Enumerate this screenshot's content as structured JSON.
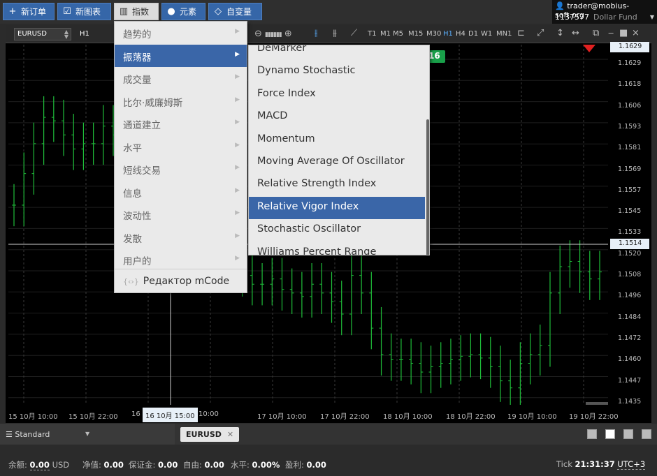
{
  "toolbar": {
    "new_order": "新订单",
    "new_chart": "新图表",
    "indicators": "指数",
    "elements": "元素",
    "variables": "自变量"
  },
  "account": {
    "user": "trader@mobius-soft.org",
    "id": "1137577",
    "fund": "Dollar Fund"
  },
  "chart_toolbar": {
    "symbol": "EURUSD",
    "timeframe": "H1",
    "timeframes": [
      "T1",
      "M1",
      "M5",
      "M15",
      "M30",
      "H1",
      "H4",
      "D1",
      "W1",
      "MN1"
    ],
    "active_timeframe": "H1"
  },
  "price_axis": {
    "ticks": [
      "1.1629",
      "1.1618",
      "1.1606",
      "1.1593",
      "1.1581",
      "1.1569",
      "1.1557",
      "1.1545",
      "1.1533",
      "1.1520",
      "1.1508",
      "1.1496",
      "1.1484",
      "1.1472",
      "1.1460",
      "1.1447",
      "1.1435"
    ],
    "current_price": "1.1514",
    "top_price": "1.1629"
  },
  "time_axis": {
    "labels": [
      "15 10月 10:00",
      "15 10月 22:00",
      "16",
      "16 10月 15:00",
      "10:00",
      "17 10月 10:00",
      "17 10月 22:00",
      "18 10月 10:00",
      "18 10月 22:00",
      "19 10月 10:00",
      "19 10月 22:00"
    ],
    "crosshair_time": "16 10月 15:00"
  },
  "chart_marker": "16",
  "menu": {
    "items": [
      "趋势的",
      "振荡器",
      "成交量",
      "比尔·威廉姆斯",
      "通道建立",
      "水平",
      "短线交易",
      "信息",
      "波动性",
      "发散",
      "用户的"
    ],
    "selected": "振荡器",
    "editor": "Редактор mCode"
  },
  "submenu": {
    "items": [
      "DeMarker",
      "Dynamo Stochastic",
      "Force Index",
      "MACD",
      "Momentum",
      "Moving Average Of Oscillator",
      "Relative Strength Index",
      "Relative Vigor Index",
      "Stochastic Oscillator",
      "Williams Percent Range"
    ],
    "selected": "Relative Vigor Index"
  },
  "tabbar": {
    "workspace": "Standard",
    "symbol_tab": "EURUSD"
  },
  "status": {
    "balance_label": "余额:",
    "balance_value": "0.00",
    "balance_currency": "USD",
    "equity_label": "净值:",
    "equity_value": "0.00",
    "margin_label": "保证金:",
    "margin_value": "0.00",
    "free_label": "自由:",
    "free_value": "0.00",
    "level_label": "水平:",
    "level_value": "0.00%",
    "profit_label": "盈利:",
    "profit_value": "0.00",
    "tick_label": "Tick",
    "time": "21:31:37",
    "timezone": "UTC+3"
  },
  "colors": {
    "accent": "#3a66a8",
    "candle": "#1fbf3a",
    "marker_green": "#19a04a",
    "marker_red": "#e02020"
  },
  "chart_data": {
    "type": "candlestick",
    "title": "",
    "symbol": "EURUSD",
    "timeframe": "H1",
    "ylim": [
      1.143,
      1.1635
    ],
    "x_tick_labels": [
      "15 10月 10:00",
      "15 10月 22:00",
      "16 10月 10:00",
      "17 10月 10:00",
      "17 10月 22:00",
      "18 10月 10:00",
      "18 10月 22:00",
      "19 10月 10:00",
      "19 10月 22:00"
    ],
    "series": [
      {
        "name": "EURUSD",
        "values": [
          1.155,
          1.1568,
          1.1585,
          1.16,
          1.1598,
          1.159,
          1.1582,
          1.1585,
          1.1585,
          1.1595,
          1.159,
          1.1586,
          1.158,
          1.1582,
          1.1575,
          1.1572,
          1.158,
          1.1585,
          1.1588,
          1.159,
          1.1584,
          1.152,
          1.1515,
          1.151,
          1.1505,
          1.1505,
          1.1508,
          1.1502,
          1.15,
          1.1498,
          1.1505,
          1.15,
          1.1495,
          1.1488,
          1.151,
          1.15,
          1.148,
          1.1465,
          1.1462,
          1.1462,
          1.146,
          1.1455,
          1.1458,
          1.146,
          1.1462,
          1.1464,
          1.1465,
          1.1463,
          1.1458,
          1.145,
          1.1446,
          1.146,
          1.1465,
          1.147,
          1.15,
          1.1515,
          1.1518,
          1.1512,
          1.1508,
          1.1512
        ]
      }
    ],
    "current_price": 1.1514
  }
}
